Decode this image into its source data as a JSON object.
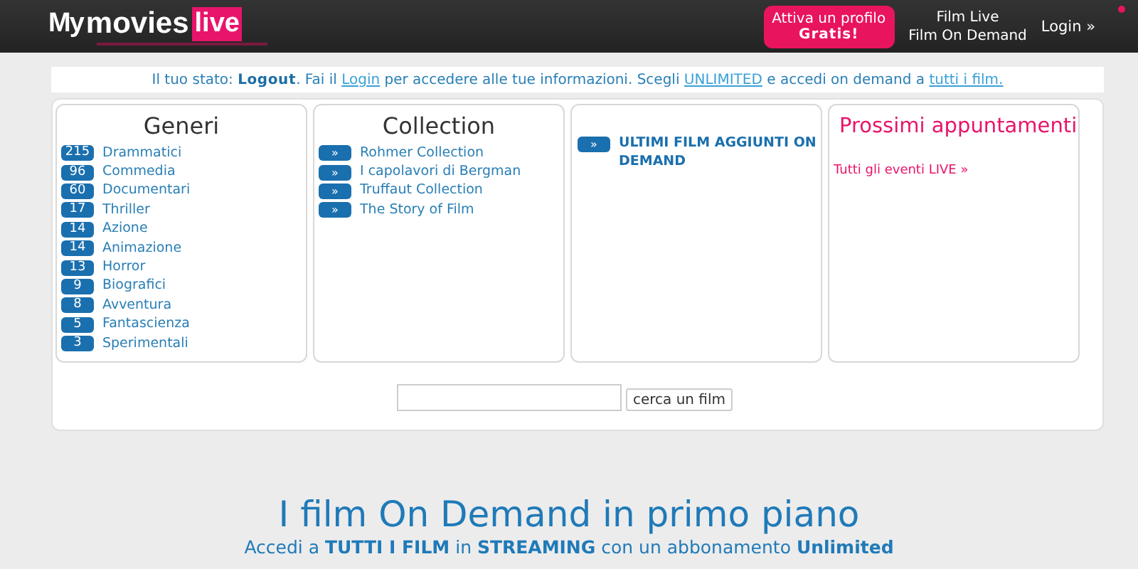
{
  "header": {
    "logo": {
      "my": "My",
      "movies": "movies",
      "live": "live"
    },
    "promo_button": {
      "line1": "Attiva un profilo",
      "line2": "Gratis!"
    },
    "nav_links": [
      "Film Live",
      "Film On Demand"
    ],
    "login": "Login »"
  },
  "status": [
    {
      "kind": "text",
      "text": "Il tuo stato: **Logout**. Fai il "
    },
    {
      "kind": "link",
      "text": "Login"
    },
    {
      "kind": "text",
      "text": " per accedere alle tue informazioni. Scegli "
    },
    {
      "kind": "link",
      "text": "UNLIMITED"
    },
    {
      "kind": "text",
      "text": " e accedi on demand a "
    },
    {
      "kind": "link",
      "text": "tutti i film."
    }
  ],
  "genres": {
    "title": "Generi",
    "items": [
      {
        "count": "215",
        "label": "Drammatici"
      },
      {
        "count": "96",
        "label": "Commedia"
      },
      {
        "count": "60",
        "label": "Documentari"
      },
      {
        "count": "17",
        "label": "Thriller"
      },
      {
        "count": "14",
        "label": "Azione"
      },
      {
        "count": "14",
        "label": "Animazione"
      },
      {
        "count": "13",
        "label": "Horror"
      },
      {
        "count": "9",
        "label": "Biografici"
      },
      {
        "count": "8",
        "label": "Avventura"
      },
      {
        "count": "5",
        "label": "Fantascienza"
      },
      {
        "count": "3",
        "label": "Sperimentali"
      }
    ]
  },
  "collection": {
    "title": "Collection",
    "items": [
      {
        "marker": "»",
        "label": "Rohmer Collection"
      },
      {
        "marker": "»",
        "label": "I capolavori di Bergman"
      },
      {
        "marker": "»",
        "label": "Truffaut Collection"
      },
      {
        "marker": "»",
        "label": "The Story of Film"
      }
    ]
  },
  "latest": {
    "marker": "»",
    "label": "ULTIMI FILM AGGIUNTI ON DEMAND"
  },
  "events": {
    "title": "Prossimi appuntamenti",
    "link": "Tutti gli eventi LIVE »"
  },
  "search": {
    "button": "cerca un film"
  },
  "featured": {
    "title": "I film On Demand in primo piano",
    "subtitle": "Accedi a **TUTTI I FILM** in **STREAMING** con un abbonamento **Unlimited**"
  }
}
